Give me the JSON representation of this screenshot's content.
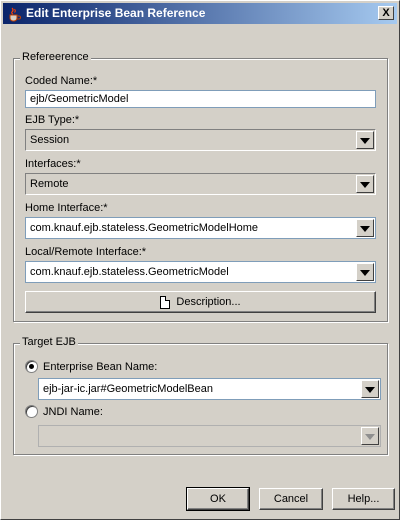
{
  "window": {
    "title": "Edit Enterprise Bean Reference",
    "close_label": "X"
  },
  "reference_group": {
    "legend": "Refereerence",
    "coded_name": {
      "label": "Coded Name:*",
      "value": "ejb/GeometricModel"
    },
    "ejb_type": {
      "label": "EJB Type:*",
      "value": "Session"
    },
    "interfaces": {
      "label": "Interfaces:*",
      "value": "Remote"
    },
    "home_interface": {
      "label": "Home Interface:*",
      "value": "com.knauf.ejb.stateless.GeometricModelHome"
    },
    "local_remote_interface": {
      "label": "Local/Remote Interface:*",
      "value": "com.knauf.ejb.stateless.GeometricModel"
    },
    "description_button": "Description..."
  },
  "target_group": {
    "legend": "Target EJB",
    "enterprise_bean_name": {
      "label": "Enterprise Bean Name:",
      "value": "ejb-jar-ic.jar#GeometricModelBean",
      "checked": true
    },
    "jndi_name": {
      "label": "JNDI Name:",
      "value": "",
      "checked": false
    }
  },
  "buttons": {
    "ok": "OK",
    "cancel": "Cancel",
    "help": "Help..."
  },
  "icons": {
    "title_icon": "java-cup-icon",
    "description_icon": "document-icon"
  }
}
